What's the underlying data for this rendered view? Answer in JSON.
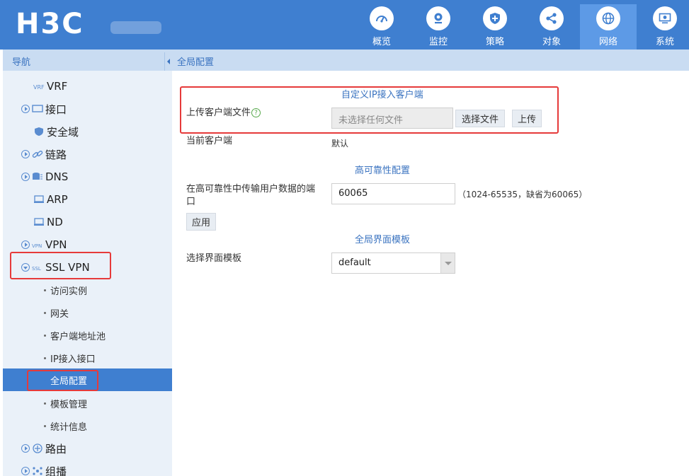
{
  "header": {
    "logo": "H3C",
    "nav": [
      {
        "label": "概览",
        "icon": "gauge-icon"
      },
      {
        "label": "监控",
        "icon": "camera-icon"
      },
      {
        "label": "策略",
        "icon": "shield-plus-icon"
      },
      {
        "label": "对象",
        "icon": "share-icon"
      },
      {
        "label": "网络",
        "icon": "globe-icon",
        "active": true
      },
      {
        "label": "系统",
        "icon": "monitor-gear-icon"
      }
    ]
  },
  "sidebar": {
    "title": "导航",
    "items": {
      "vrf": "VRF",
      "interface": "接口",
      "security_zone": "安全域",
      "link": "链路",
      "dns": "DNS",
      "arp": "ARP",
      "nd": "ND",
      "vpn": "VPN",
      "ssl_vpn": "SSL VPN",
      "routing": "路由",
      "multicast": "组播"
    },
    "ssl_vpn_children": [
      "访问实例",
      "网关",
      "客户端地址池",
      "IP接入接口",
      "全局配置",
      "模板管理",
      "统计信息"
    ],
    "active_child": "全局配置"
  },
  "breadcrumb": "全局配置",
  "sections": {
    "custom_client": {
      "title": "自定义IP接入客户端",
      "upload_label": "上传客户端文件",
      "file_placeholder": "未选择任何文件",
      "choose_file_btn": "选择文件",
      "upload_btn": "上传",
      "current_client_label": "当前客户端",
      "current_client_value": "默认"
    },
    "ha": {
      "title": "高可靠性配置",
      "port_label_line1": "在高可靠性中传输用户数据的端",
      "port_label_line2": "口",
      "port_value": "60065",
      "port_hint": "（1024-65535，缺省为60065）",
      "apply_btn": "应用"
    },
    "template": {
      "title": "全局界面模板",
      "select_label": "选择界面模板",
      "select_value": "default"
    }
  },
  "colors": {
    "header_bg": "#3f7fd0",
    "active_nav_bg": "#5d9ae6",
    "sidebar_bg": "#eaf1f9",
    "accent_text": "#3a73c0",
    "highlight_border": "#e63a3a"
  }
}
